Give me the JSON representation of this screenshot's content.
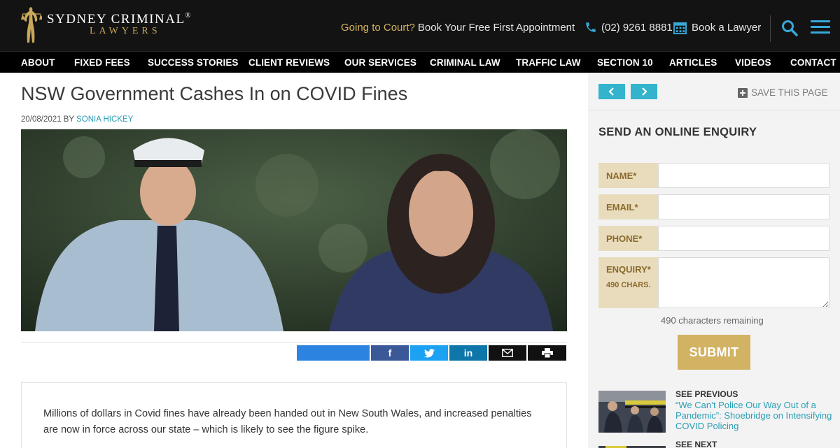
{
  "header": {
    "logo_name": "SYDNEY CRIMINAL",
    "logo_reg": "®",
    "logo_sub": "LAWYERS",
    "court_question": "Going to Court?",
    "court_offer": "Book Your Free First Appointment",
    "phone": "(02) 9261 8881",
    "book_lawyer": "Book a Lawyer"
  },
  "nav": {
    "items": [
      "ABOUT",
      "FIXED FEES",
      "SUCCESS STORIES",
      "CLIENT REVIEWS",
      "OUR SERVICES",
      "CRIMINAL LAW",
      "TRAFFIC LAW",
      "SECTION 10",
      "ARTICLES",
      "VIDEOS",
      "CONTACT"
    ]
  },
  "article": {
    "title": "NSW Government Cashes In on COVID Fines",
    "date": "20/08/2021",
    "by": "BY",
    "author": "SONIA HICKEY",
    "body": "Millions of dollars in Covid fines have already been handed out in New South Wales, and increased penalties are now in force across our state – which is likely to see the figure spike."
  },
  "share": {
    "facebook": "f",
    "twitter_icon": "twitter-icon",
    "linkedin": "in",
    "email_icon": "email-icon",
    "print_icon": "print-icon"
  },
  "sidebar": {
    "save_page": "SAVE THIS PAGE",
    "enquiry_title": "SEND AN ONLINE ENQUIRY",
    "fields": {
      "name": "NAME*",
      "email": "EMAIL*",
      "phone": "PHONE*",
      "enquiry": "ENQUIRY*",
      "enquiry_chars": "490 CHARS."
    },
    "remaining": "490 characters remaining",
    "submit": "SUBMIT",
    "previous_label": "SEE PREVIOUS",
    "previous_title": "“We Can’t Police Our Way Out of a Pandemic”: Shoebridge on Intensifying COVID Policing",
    "next_label": "SEE NEXT"
  },
  "colors": {
    "accent_gold": "#d2b263",
    "accent_teal": "#33b4cc",
    "link": "#2a9fb6",
    "header_bg": "#131313"
  }
}
